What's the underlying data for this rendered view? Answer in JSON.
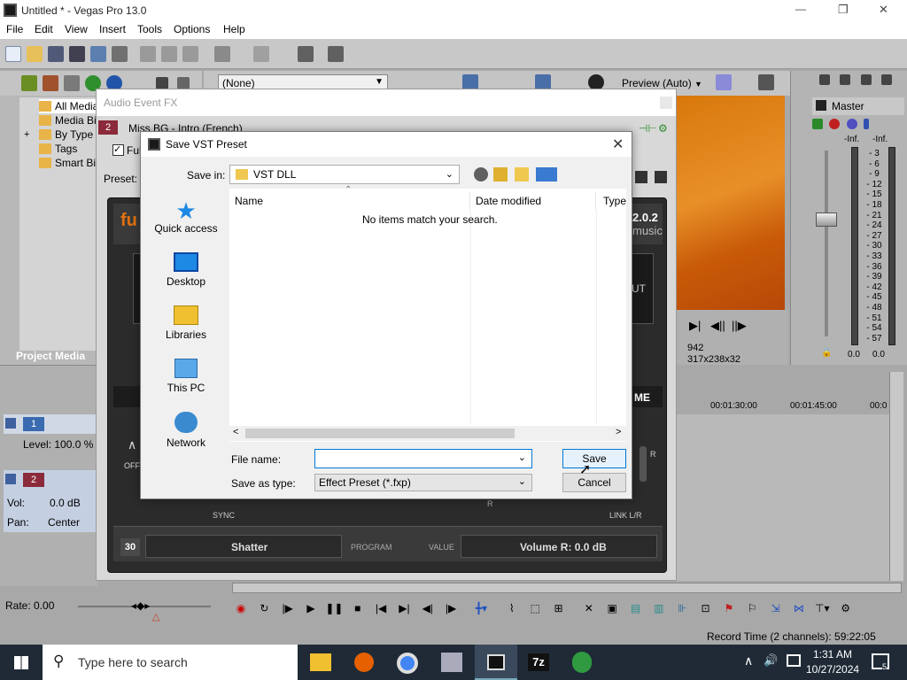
{
  "app": {
    "title": "Untitled * - Vegas Pro 13.0",
    "menu": [
      "File",
      "Edit",
      "View",
      "Insert",
      "Tools",
      "Options",
      "Help"
    ],
    "title_buttons": {
      "minimize": "—",
      "restore": "❐",
      "close": "✕"
    }
  },
  "toolbar2": {
    "preset_value": "(None)",
    "preview_label": "Preview (Auto)"
  },
  "explorer": {
    "items": [
      "All Media",
      "Media Bin",
      "By Type",
      "Tags",
      "Smart Bin"
    ],
    "footer": "Project Media",
    "expand": "+"
  },
  "master": {
    "label": "Master",
    "inf": [
      "-Inf.",
      "-Inf."
    ],
    "scale": [
      "3",
      "6",
      "9",
      "12",
      "15",
      "18",
      "21",
      "24",
      "27",
      "30",
      "33",
      "36",
      "39",
      "42",
      "45",
      "48",
      "51",
      "54",
      "57"
    ],
    "bottom": [
      "0.0",
      "0.0"
    ]
  },
  "preview_panel": {
    "frame": "942",
    "display": "317x238x32"
  },
  "timeline": {
    "times": [
      "00:01:30:00",
      "00:01:45:00",
      "00:0"
    ],
    "tracks": [
      {
        "num": "1",
        "level": "Level: 100.0 %"
      },
      {
        "num": "2",
        "vol_label": "Vol:",
        "vol_value": "0.0 dB",
        "pan_label": "Pan:",
        "pan_value": "Center"
      }
    ],
    "rate": "Rate: 0.00",
    "record_time": "Record Time (2 channels): 59:22:05"
  },
  "audio_fx": {
    "title": "Audio Event FX",
    "chain_num": "2",
    "chain_name": "Miss BG - Intro (French)",
    "checkbox_label": "Full",
    "preset_label": "Preset:",
    "plugin": {
      "version": "2.0.2",
      "brand_right": "music",
      "label_out": "UT",
      "label_me": "ME",
      "label_off": "OFF",
      "label_sync": "SYNC",
      "label_link": "LINK L/R",
      "label_r": "R",
      "program_num": "30",
      "program_name": "Shatter",
      "program_label": "PROGRAM",
      "value_label": "VALUE",
      "value": "Volume R: 0.0 dB"
    }
  },
  "dialog": {
    "title": "Save VST Preset",
    "save_in_label": "Save in:",
    "save_in_value": "VST DLL",
    "nav": [
      "Quick access",
      "Desktop",
      "Libraries",
      "This PC",
      "Network"
    ],
    "columns": [
      "Name",
      "Date modified",
      "Type"
    ],
    "empty_message": "No items match your search.",
    "file_name_label": "File name:",
    "file_name_value": "",
    "save_type_label": "Save as type:",
    "save_type_value": "Effect Preset (*.fxp)",
    "save_button": "Save",
    "cancel_button": "Cancel"
  },
  "taskbar": {
    "search_placeholder": "Type here to search",
    "time": "1:31 AM",
    "date": "10/27/2024",
    "notification_count": "5",
    "app_7z": "7z"
  }
}
